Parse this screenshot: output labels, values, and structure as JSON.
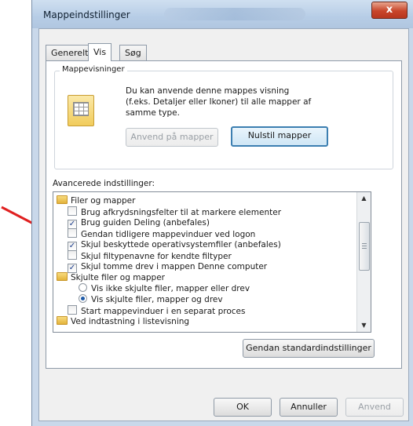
{
  "window": {
    "title": "Mappeindstillinger",
    "close_glyph": "x"
  },
  "tabs": [
    {
      "label": "Generelt",
      "active": false
    },
    {
      "label": "Vis",
      "active": true
    },
    {
      "label": "Søg",
      "active": false
    }
  ],
  "folder_views": {
    "legend": "Mappevisninger",
    "description": "Du kan anvende denne mappes visning (f.eks. Detaljer eller Ikoner) til alle mapper af samme type.",
    "apply_label": "Anvend på mapper",
    "reset_label": "Nulstil mapper",
    "icon": "folder-view-icon"
  },
  "advanced": {
    "label": "Avancerede indstillinger:",
    "items": [
      {
        "type": "folder",
        "label": "Filer og mapper"
      },
      {
        "type": "checkbox",
        "checked": false,
        "label": "Brug afkrydsningsfelter til at markere elementer"
      },
      {
        "type": "checkbox",
        "checked": true,
        "label": "Brug guiden Deling (anbefales)"
      },
      {
        "type": "checkbox",
        "checked": false,
        "label": "Gendan tidligere mappevinduer ved logon"
      },
      {
        "type": "checkbox",
        "checked": true,
        "label": "Skjul beskyttede operativsystemfiler (anbefales)"
      },
      {
        "type": "checkbox",
        "checked": false,
        "label": "Skjul filtypenavne for kendte filtyper"
      },
      {
        "type": "checkbox",
        "checked": true,
        "label": "Skjul tomme drev i mappen Denne computer"
      },
      {
        "type": "folder",
        "label": "Skjulte filer og mapper"
      },
      {
        "type": "radio",
        "checked": false,
        "label": "Vis ikke skjulte filer, mapper eller drev"
      },
      {
        "type": "radio",
        "checked": true,
        "label": "Vis skjulte filer, mapper og drev"
      },
      {
        "type": "checkbox",
        "checked": false,
        "label": "Start mappevinduer i en separat proces"
      },
      {
        "type": "folder",
        "label": "Ved indtastning i listevisning"
      }
    ]
  },
  "restore_defaults_label": "Gendan standardindstillinger",
  "buttons": {
    "ok": "OK",
    "cancel": "Annuller",
    "apply": "Anvend"
  },
  "check_glyph": "✓",
  "annotation": {
    "color": "#e02020"
  }
}
